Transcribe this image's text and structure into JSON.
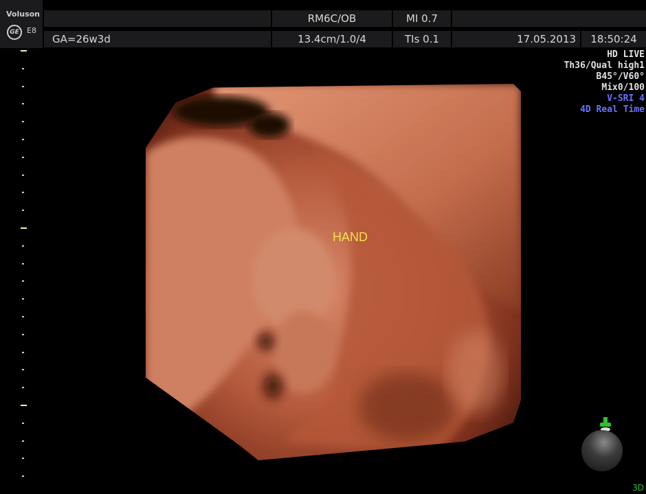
{
  "device": {
    "brand": "Voluson",
    "model": "E8",
    "logo": "ge-logo-icon"
  },
  "header": {
    "probe_mode": "RM6C/OB",
    "mi": "MI 0.7",
    "gestational_age": "GA=26w3d",
    "depth_settings": "13.4cm/1.0/4",
    "tis": "TIs 0.1",
    "date": "17.05.2013",
    "time": "18:50:24"
  },
  "imaging_params": {
    "mode": "HD LIVE",
    "threshold_quality": "Th36/Qual high1",
    "angles": "B45°/V60°",
    "mix": "Mix0/100",
    "vsri": "V-SRI 4",
    "realtime": "4D Real Time"
  },
  "annotation": {
    "label": "HAND"
  },
  "orientation": {
    "mode_label": "3D"
  },
  "colors": {
    "header_bg": "#1b1b1d",
    "blue_text": "#6c73ff",
    "annotation": "#f2e34a",
    "skin": "#c96a48"
  }
}
